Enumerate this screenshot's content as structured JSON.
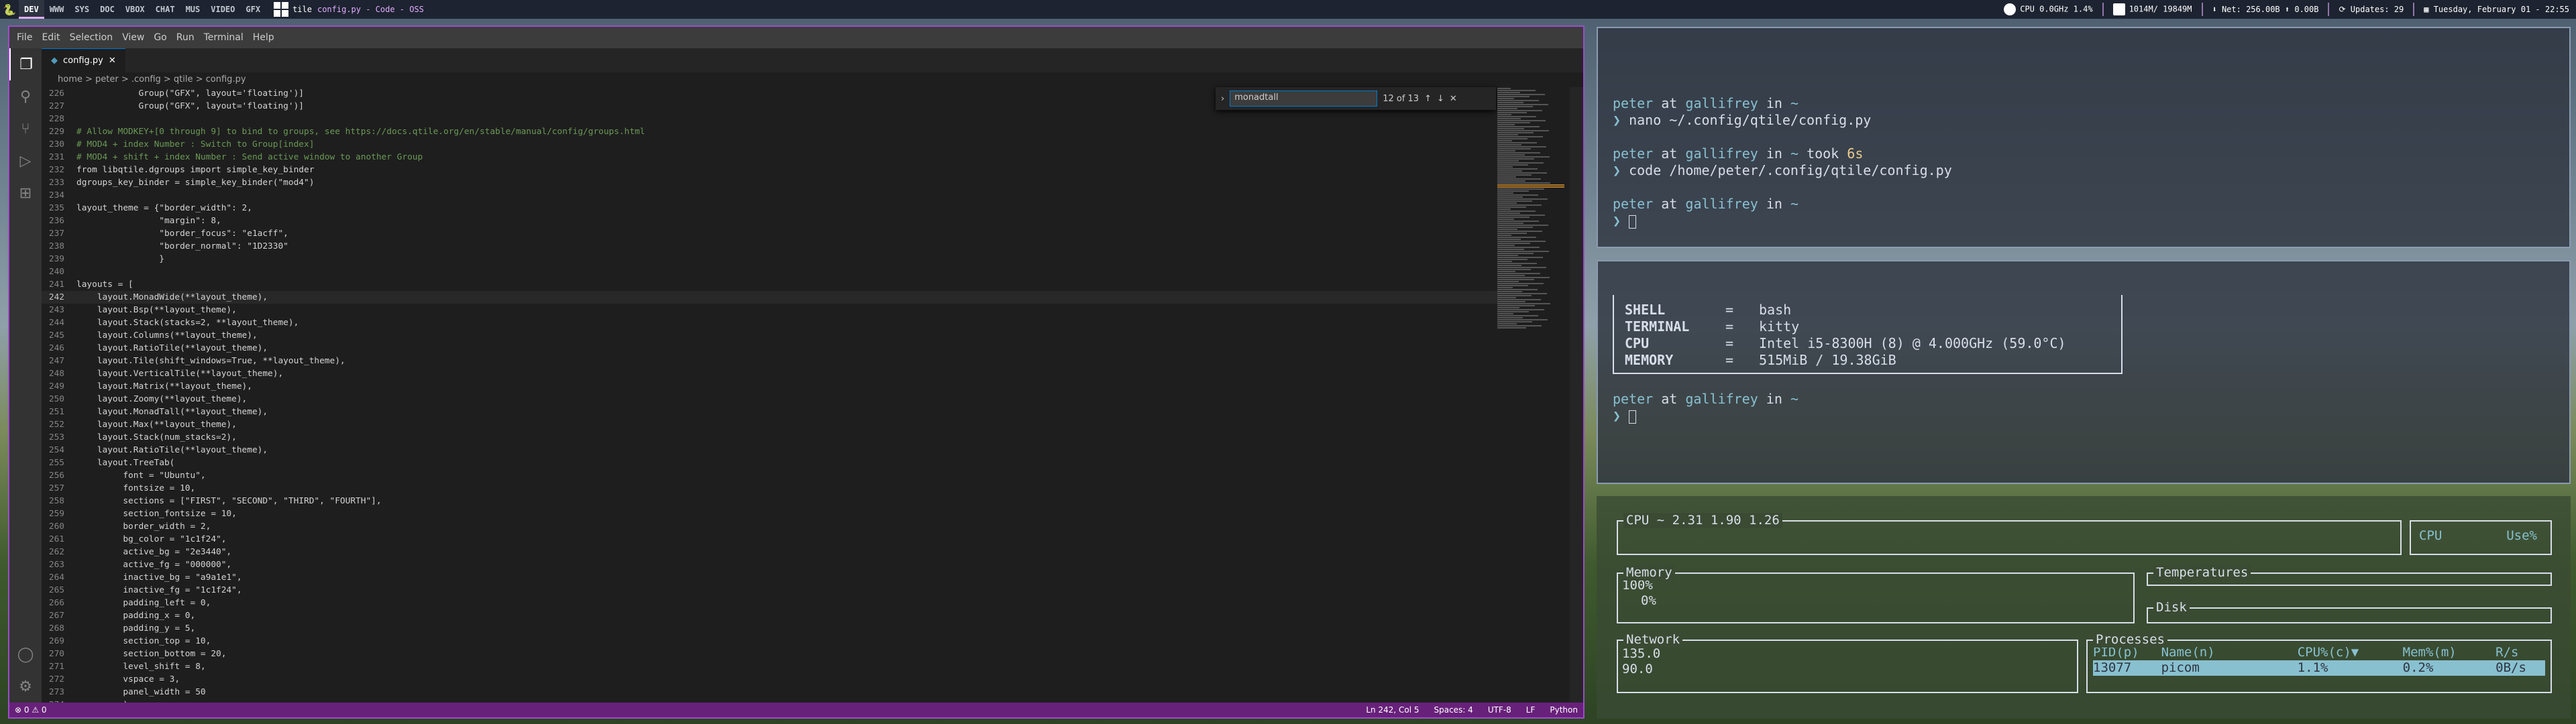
{
  "bar": {
    "groups": [
      "DEV",
      "WWW",
      "SYS",
      "DOC",
      "VBOX",
      "CHAT",
      "MUS",
      "VIDEO",
      "GFX"
    ],
    "active": "DEV",
    "layout": "tile",
    "window_title": "config.py - Code - OSS",
    "cpu": "CPU 0.0GHz 1.4%",
    "mem": "1014M/ 19849M",
    "net": "Net: 256.00B",
    "net2": "0.00B",
    "updates": "Updates: 29",
    "date": "Tuesday, February 01 - 22:55"
  },
  "code": {
    "menu": [
      "File",
      "Edit",
      "Selection",
      "View",
      "Go",
      "Run",
      "Terminal",
      "Help"
    ],
    "tab": "config.py",
    "breadcrumb": "home > peter > .config > qtile > config.py",
    "find": {
      "value": "monadtall",
      "count": "12 of 13"
    },
    "lines": [
      {
        "n": "226",
        "t": "            Group(\"GFX\", layout='floating')]"
      },
      {
        "n": "227",
        "t": "            Group(\"GFX\", layout='floating')]"
      },
      {
        "n": "228",
        "t": ""
      },
      {
        "n": "229",
        "t": "# Allow MODKEY+[0 through 9] to bind to groups, see https://docs.qtile.org/en/stable/manual/config/groups.html"
      },
      {
        "n": "230",
        "t": "# MOD4 + index Number : Switch to Group[index]"
      },
      {
        "n": "231",
        "t": "# MOD4 + shift + index Number : Send active window to another Group"
      },
      {
        "n": "232",
        "t": "from libqtile.dgroups import simple_key_binder"
      },
      {
        "n": "233",
        "t": "dgroups_key_binder = simple_key_binder(\"mod4\")"
      },
      {
        "n": "234",
        "t": ""
      },
      {
        "n": "235",
        "t": "layout_theme = {\"border_width\": 2,"
      },
      {
        "n": "236",
        "t": "                \"margin\": 8,"
      },
      {
        "n": "237",
        "t": "                \"border_focus\": \"e1acff\","
      },
      {
        "n": "238",
        "t": "                \"border_normal\": \"1D2330\""
      },
      {
        "n": "239",
        "t": "                }"
      },
      {
        "n": "240",
        "t": ""
      },
      {
        "n": "241",
        "t": "layouts = ["
      },
      {
        "n": "242",
        "t": "    layout.MonadWide(**layout_theme),"
      },
      {
        "n": "243",
        "t": "    layout.Bsp(**layout_theme),"
      },
      {
        "n": "244",
        "t": "    layout.Stack(stacks=2, **layout_theme),"
      },
      {
        "n": "245",
        "t": "    layout.Columns(**layout_theme),"
      },
      {
        "n": "246",
        "t": "    layout.RatioTile(**layout_theme),"
      },
      {
        "n": "247",
        "t": "    layout.Tile(shift_windows=True, **layout_theme),"
      },
      {
        "n": "248",
        "t": "    layout.VerticalTile(**layout_theme),"
      },
      {
        "n": "249",
        "t": "    layout.Matrix(**layout_theme),"
      },
      {
        "n": "250",
        "t": "    layout.Zoomy(**layout_theme),"
      },
      {
        "n": "251",
        "t": "    layout.MonadTall(**layout_theme),"
      },
      {
        "n": "252",
        "t": "    layout.Max(**layout_theme),"
      },
      {
        "n": "253",
        "t": "    layout.Stack(num_stacks=2),"
      },
      {
        "n": "254",
        "t": "    layout.RatioTile(**layout_theme),"
      },
      {
        "n": "255",
        "t": "    layout.TreeTab("
      },
      {
        "n": "256",
        "t": "         font = \"Ubuntu\","
      },
      {
        "n": "257",
        "t": "         fontsize = 10,"
      },
      {
        "n": "258",
        "t": "         sections = [\"FIRST\", \"SECOND\", \"THIRD\", \"FOURTH\"],"
      },
      {
        "n": "259",
        "t": "         section_fontsize = 10,"
      },
      {
        "n": "260",
        "t": "         border_width = 2,"
      },
      {
        "n": "261",
        "t": "         bg_color = \"1c1f24\","
      },
      {
        "n": "262",
        "t": "         active_bg = \"2e3440\","
      },
      {
        "n": "263",
        "t": "         active_fg = \"000000\","
      },
      {
        "n": "264",
        "t": "         inactive_bg = \"a9a1e1\","
      },
      {
        "n": "265",
        "t": "         inactive_fg = \"1c1f24\","
      },
      {
        "n": "266",
        "t": "         padding_left = 0,"
      },
      {
        "n": "267",
        "t": "         padding_x = 0,"
      },
      {
        "n": "268",
        "t": "         padding_y = 5,"
      },
      {
        "n": "269",
        "t": "         section_top = 10,"
      },
      {
        "n": "270",
        "t": "         section_bottom = 20,"
      },
      {
        "n": "271",
        "t": "         level_shift = 8,"
      },
      {
        "n": "272",
        "t": "         vspace = 3,"
      },
      {
        "n": "273",
        "t": "         panel_width = 50"
      },
      {
        "n": "274",
        "t": "         ),"
      }
    ],
    "status": {
      "left": "⊗ 0 ⚠ 0",
      "pos": "Ln 242, Col 5",
      "spaces": "Spaces: 4",
      "enc": "UTF-8",
      "eol": "LF",
      "lang": "Python"
    }
  },
  "term1": {
    "user": "peter",
    "at": "at",
    "host": "gallifrey",
    "in": "in",
    "path": "~",
    "cmd1": "nano ~/.config/qtile/config.py",
    "took": "took",
    "secs": "6s",
    "cmd2": "code /home/peter/.config/qtile/config.py"
  },
  "term2": {
    "rows": [
      [
        "SHELL",
        "=",
        "bash"
      ],
      [
        "TERMINAL",
        "=",
        "kitty"
      ],
      [
        "CPU",
        "=",
        "Intel i5-8300H (8) @ 4.000GHz (59.0°C)"
      ],
      [
        "MEMORY",
        "=",
        "515MiB / 19.38GiB"
      ]
    ],
    "user": "peter",
    "host": "gallifrey",
    "path": "~"
  },
  "bpytop": {
    "cpu_label": "CPU ~ 2.31 1.90 1.26",
    "cpu_hdr": "CPU",
    "use_hdr": "Use%",
    "mem": "Memory",
    "mem100": "100%",
    "mem0": "0%",
    "temps": "Temperatures",
    "disk": "Disk",
    "net": "Network",
    "net1": "135.0",
    "net2": "90.0",
    "proc": "Processes",
    "cols": [
      "PID(p)",
      "Name(n)",
      "CPU%(c)▼",
      "Mem%(m)",
      "R/s"
    ],
    "row": [
      "13077",
      "picom",
      "1.1%",
      "0.2%",
      "0B/s"
    ]
  }
}
